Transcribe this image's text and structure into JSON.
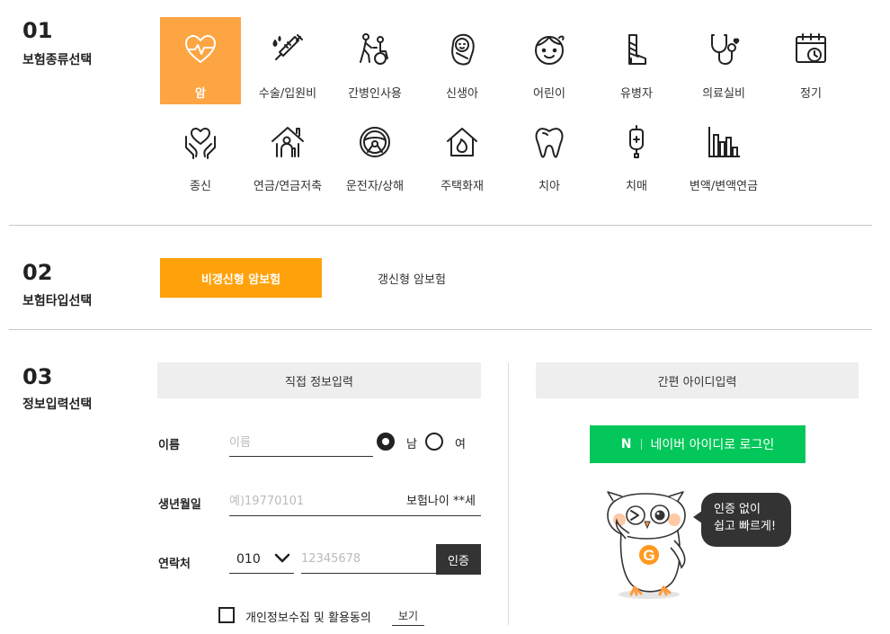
{
  "section1": {
    "num": "01",
    "title": "보험종류선택",
    "items": [
      {
        "label": "암",
        "icon": "heart-pulse-icon",
        "active": true
      },
      {
        "label": "수술/입원비",
        "icon": "syringe-icon"
      },
      {
        "label": "간병인사용",
        "icon": "caregiver-wheelchair-icon"
      },
      {
        "label": "신생아",
        "icon": "newborn-baby-icon"
      },
      {
        "label": "어린이",
        "icon": "child-face-icon"
      },
      {
        "label": "유병자",
        "icon": "leg-cast-icon"
      },
      {
        "label": "의료실비",
        "icon": "stethoscope-icon"
      },
      {
        "label": "정기",
        "icon": "calendar-clock-icon"
      },
      {
        "label": "종신",
        "icon": "hands-heart-icon"
      },
      {
        "label": "연금/연금저축",
        "icon": "elder-house-icon"
      },
      {
        "label": "운전자/상해",
        "icon": "steering-wheel-icon"
      },
      {
        "label": "주택화재",
        "icon": "house-fire-icon"
      },
      {
        "label": "치아",
        "icon": "tooth-icon"
      },
      {
        "label": "치매",
        "icon": "iv-drip-icon"
      },
      {
        "label": "변액/변액연금",
        "icon": "bar-chart-icon"
      }
    ]
  },
  "section2": {
    "num": "02",
    "title": "보험타입선택",
    "options": [
      {
        "label": "비갱신형 암보험",
        "active": true
      },
      {
        "label": "갱신형 암보험"
      }
    ]
  },
  "section3": {
    "num": "03",
    "title": "정보입력선택",
    "direct_tab": "직접 정보입력",
    "simple_tab": "간편 아이디입력",
    "name_label": "이름",
    "name_placeholder": "이름",
    "gender_male": "남",
    "gender_female": "여",
    "birth_label": "생년월일",
    "birth_placeholder": "예)19770101",
    "insurance_age": "보험나이 **세",
    "phone_label": "연락처",
    "phone_prefix": "010",
    "phone_placeholder": "12345678",
    "auth_button": "인증",
    "agree_label": "개인정보수집 및 활용동의",
    "view_link": "보기",
    "naver_logo": "N",
    "naver_button": "네이버 아이디로 로그인",
    "bubble_line1": "인증 없이",
    "bubble_line2": "쉽고 빠르게!",
    "mascot_badge": "G"
  },
  "colors": {
    "accent": "#ffa10a",
    "tile_active": "#fca542",
    "naver": "#03c75a",
    "dark": "#333333"
  }
}
